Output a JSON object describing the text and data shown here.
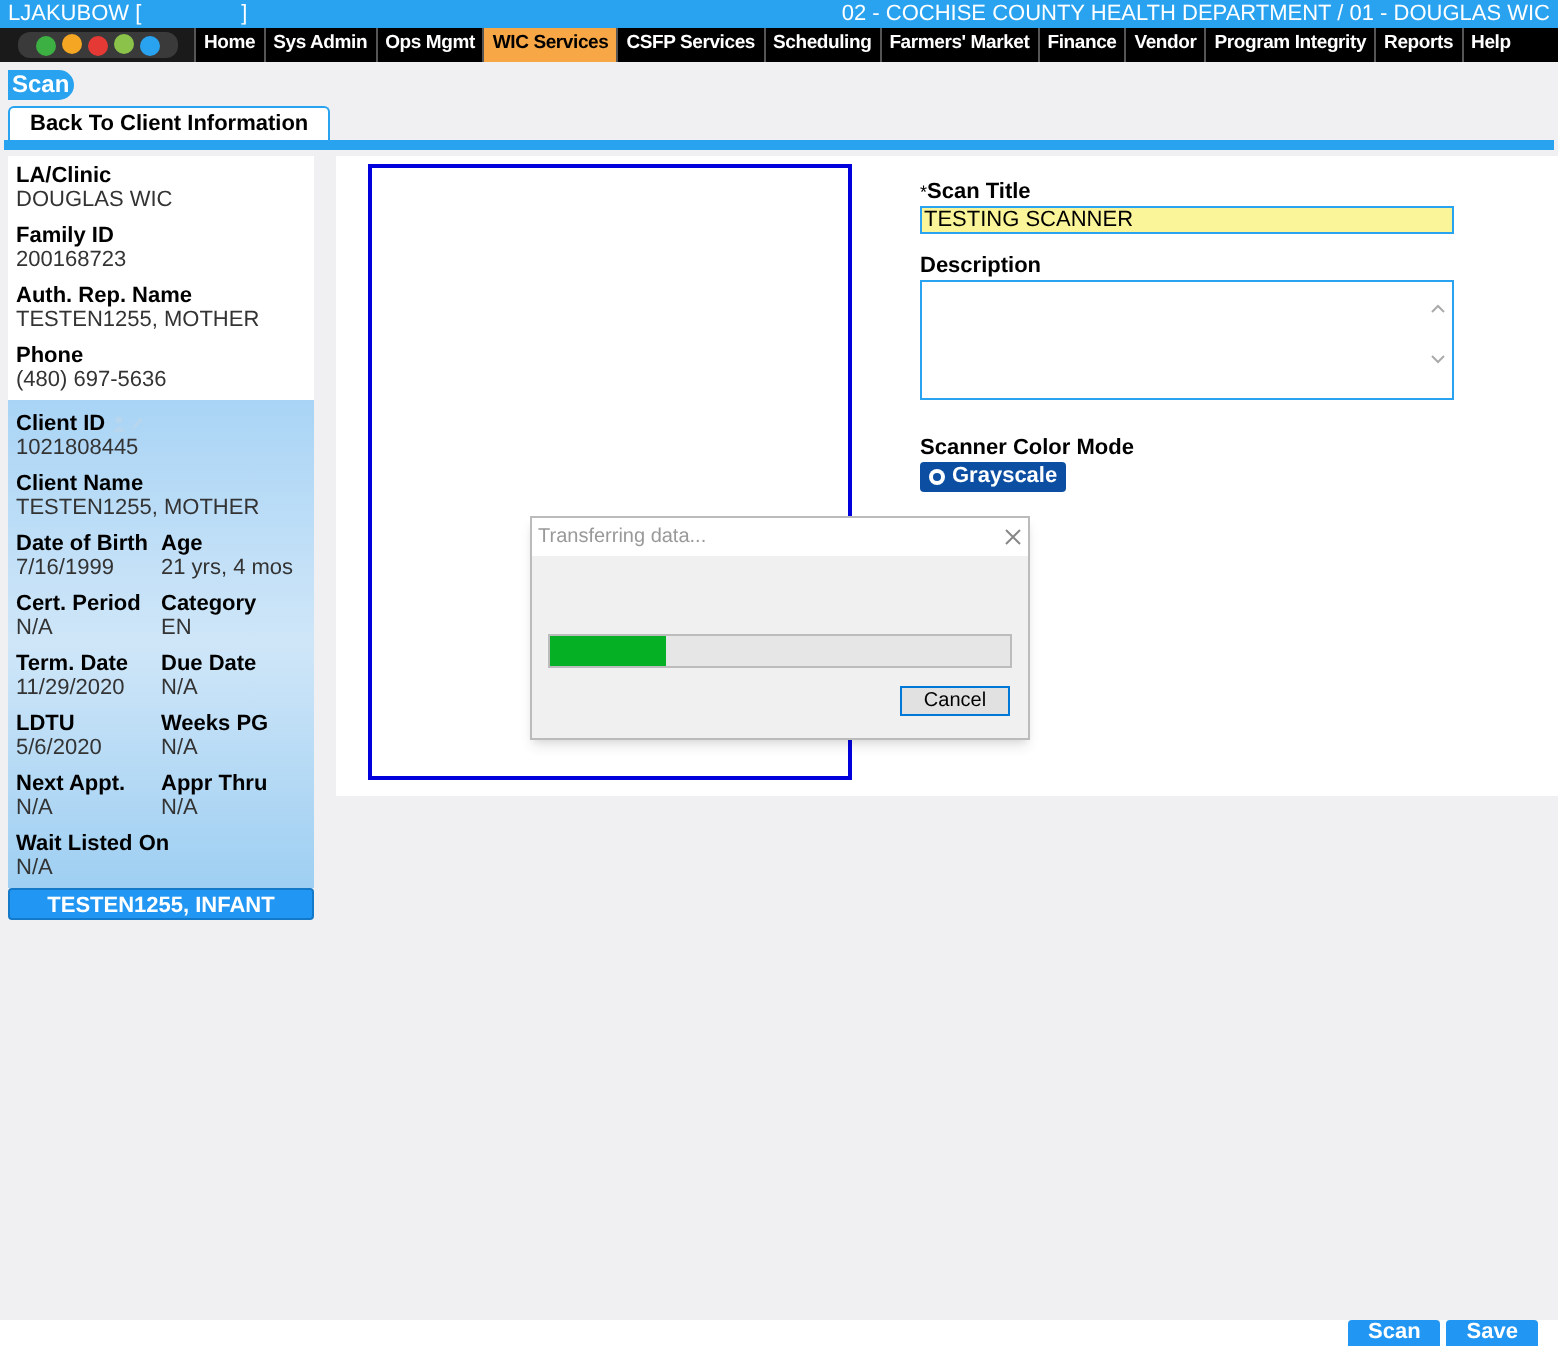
{
  "header": {
    "user_prefix": "LJAKUBOW [",
    "user_suffix": "]",
    "location": "02 - COCHISE COUNTY HEALTH DEPARTMENT / 01 - DOUGLAS WIC"
  },
  "nav": [
    {
      "label": "Home",
      "selected": false
    },
    {
      "label": "Sys Admin",
      "selected": false
    },
    {
      "label": "Ops Mgmt",
      "selected": false
    },
    {
      "label": "WIC Services",
      "selected": true
    },
    {
      "label": "CSFP Services",
      "selected": false
    },
    {
      "label": "Scheduling",
      "selected": false
    },
    {
      "label": "Farmers' Market",
      "selected": false
    },
    {
      "label": "Finance",
      "selected": false
    },
    {
      "label": "Vendor",
      "selected": false
    },
    {
      "label": "Program Integrity",
      "selected": false
    },
    {
      "label": "Reports",
      "selected": false
    },
    {
      "label": "Help",
      "selected": false
    }
  ],
  "page_title": "Scan",
  "back_button": "Back To Client Information",
  "family_info": [
    {
      "label": "LA/Clinic",
      "value": "DOUGLAS WIC"
    },
    {
      "label": "Family ID",
      "value": "200168723"
    },
    {
      "label": "Auth. Rep. Name",
      "value": "TESTEN1255, MOTHER"
    },
    {
      "label": "Phone",
      "value": "(480) 697-5636"
    }
  ],
  "client_info": [
    [
      {
        "label": "Client ID",
        "value": "1021808445",
        "icons": true
      }
    ],
    [
      {
        "label": "Client Name",
        "value": "TESTEN1255, MOTHER"
      }
    ],
    [
      {
        "label": "Date of Birth",
        "value": "7/16/1999"
      },
      {
        "label": "Age",
        "value": "21 yrs, 4 mos"
      }
    ],
    [
      {
        "label": "Cert. Period",
        "value": "N/A"
      },
      {
        "label": "Category",
        "value": "EN"
      }
    ],
    [
      {
        "label": "Term. Date",
        "value": "11/29/2020"
      },
      {
        "label": "Due Date",
        "value": "N/A"
      }
    ],
    [
      {
        "label": "LDTU",
        "value": "5/6/2020"
      },
      {
        "label": "Weeks PG",
        "value": "N/A"
      }
    ],
    [
      {
        "label": "Next Appt.",
        "value": "N/A"
      },
      {
        "label": "Appr Thru",
        "value": "N/A"
      }
    ],
    [
      {
        "label": "Wait Listed On",
        "value": "N/A"
      }
    ]
  ],
  "family_members": [
    {
      "label": "TESTEN1255, INFANT"
    }
  ],
  "scan_form": {
    "title": {
      "label": "Scan Title",
      "required_mark": "*",
      "value": "TESTING SCANNER"
    },
    "description": {
      "label": "Description"
    },
    "color_mode": {
      "label": "Scanner Color Mode",
      "options": [
        {
          "label": "Grayscale",
          "selected": true
        }
      ]
    }
  },
  "dialog": {
    "title": "Transferring data...",
    "level": 0.25,
    "cancel": "Cancel"
  },
  "footer_buttons": [
    "Scan",
    "Save"
  ]
}
